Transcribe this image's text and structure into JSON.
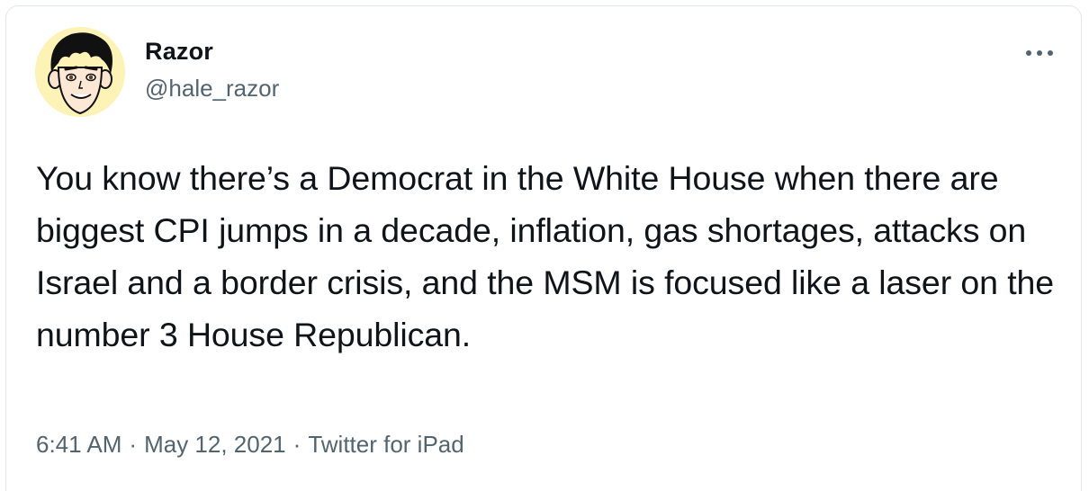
{
  "tweet": {
    "author": {
      "name": "Razor",
      "handle": "@hale_razor",
      "avatar_icon": "cartoon-face-avatar"
    },
    "more_icon": "more-horizontal-icon",
    "text": "You know there’s a Democrat in the White House when there are biggest CPI jumps in a decade, inflation, gas shortages, attacks on Israel and a border crisis, and the MSM is focused like a laser on the number 3 House Republican.",
    "time": "6:41 AM",
    "separator": "·",
    "date": "May 12, 2021",
    "source": "Twitter for iPad"
  },
  "colors": {
    "text_primary": "#0f1419",
    "text_secondary": "#536471",
    "border": "#e1e8ed",
    "avatar_bg": "#fdf3b6"
  }
}
